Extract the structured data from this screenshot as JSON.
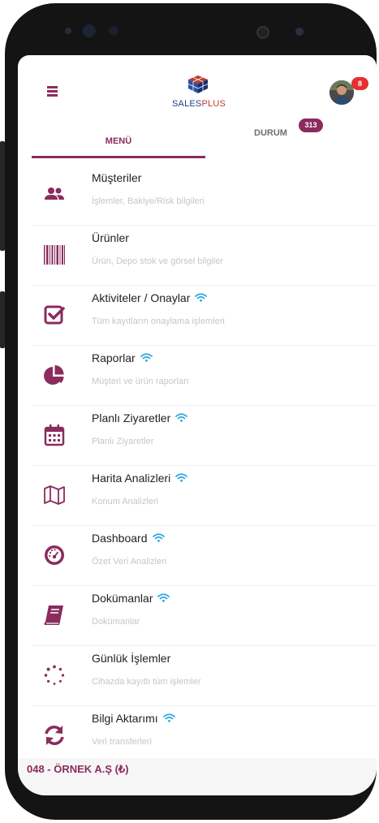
{
  "header": {
    "logo_text_part1": "SALES",
    "logo_text_part2": "PLUS",
    "notification_count": "8"
  },
  "tabs": {
    "menu_label": "MENÜ",
    "status_label": "DURUM",
    "status_count": "313"
  },
  "menu": [
    {
      "title": "Müşteriler",
      "subtitle": "İşlemler, Bakiye/Risk bilgileri",
      "icon": "users-icon",
      "wifi": false
    },
    {
      "title": "Ürünler",
      "subtitle": "Ürün, Depo stok ve görsel bilgiler",
      "icon": "barcode-icon",
      "wifi": false
    },
    {
      "title": "Aktiviteler / Onaylar",
      "subtitle": "Tüm kayıtların onaylama işlemleri",
      "icon": "checkbox-icon",
      "wifi": true
    },
    {
      "title": "Raporlar",
      "subtitle": "Müşteri ve ürün raporları",
      "icon": "pie-chart-icon",
      "wifi": true
    },
    {
      "title": "Planlı Ziyaretler",
      "subtitle": "Planlı Ziyaretler",
      "icon": "calendar-icon",
      "wifi": true
    },
    {
      "title": "Harita Analizleri",
      "subtitle": "Konum Analizleri",
      "icon": "map-icon",
      "wifi": true
    },
    {
      "title": "Dashboard",
      "subtitle": "Özet Veri Analizleri",
      "icon": "dashboard-gauge-icon",
      "wifi": true
    },
    {
      "title": "Dokümanlar",
      "subtitle": "Dokümanlar",
      "icon": "book-icon",
      "wifi": true
    },
    {
      "title": "Günlük İşlemler",
      "subtitle": "Cihazda kayıtlı tüm işlemler",
      "icon": "spinner-icon",
      "wifi": false
    },
    {
      "title": "Bilgi Aktarımı",
      "subtitle": "Veri transferleri",
      "icon": "sync-icon",
      "wifi": true
    }
  ],
  "footer": {
    "company": "048 - ÖRNEK A.Ş (₺)"
  },
  "colors": {
    "brand": "#8b2b5e",
    "wifi": "#2aa8e0",
    "notification": "#e53030"
  }
}
